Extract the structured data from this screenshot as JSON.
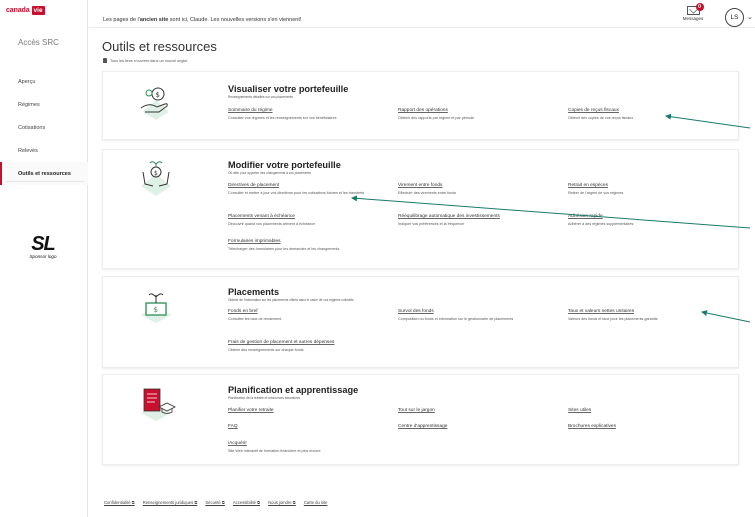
{
  "brand": {
    "name": "canada",
    "tag": "vie"
  },
  "sidebar": {
    "title": "Accès SRC",
    "items": [
      {
        "label": "Aperçu"
      },
      {
        "label": "Régimes"
      },
      {
        "label": "Cotisations"
      },
      {
        "label": "Relevés"
      },
      {
        "label": "Outils et ressources"
      }
    ],
    "sponsor_mono": "SL",
    "sponsor_sub": "Sponsor logo"
  },
  "header": {
    "banner_pre": "Les pages de l'",
    "banner_bold": "ancien site",
    "banner_post": " sont ici, Claude. Les nouvelles versions s'en viennent!",
    "messages_label": "Messages",
    "messages_count": "0",
    "avatar_initials": "LS",
    "caret": "⌄"
  },
  "page": {
    "title": "Outils et ressources",
    "note": "Tous les liens s'ouvrent dans un nouvel onglet"
  },
  "sections": {
    "s1": {
      "title": "Visualiser votre portefeuille",
      "subtitle": "Renseignements détaillés sur vos placements",
      "links": [
        {
          "label": "Sommaire du régime",
          "desc": "Consulter vos régimes et les renseignements sur vos bénéficiaires"
        },
        {
          "label": "Rapport des opérations",
          "desc": "Obtenir des rapports par régime et par période"
        },
        {
          "label": "Copies de reçus fiscaux",
          "desc": "Obtenir des copies de vos reçus fiscaux"
        }
      ]
    },
    "s2": {
      "title": "Modifier votre portefeuille",
      "subtitle": "Où aller pour apporter des changements à vos placements",
      "links": [
        {
          "label": "Directives de placement",
          "desc": "Consulter et mettre à jour vos directives pour les cotisations futures et les transferts"
        },
        {
          "label": "Virement entre fonds",
          "desc": "Effectuer des virements entre fonds"
        },
        {
          "label": "Retrait en espèces",
          "desc": "Retirer de l'argent de vos régimes"
        },
        {
          "label": "Placements venant à échéance",
          "desc": "Découvrir quand vos placements arrivent à échéance"
        },
        {
          "label": "Rééquilibrage automatique des investissements",
          "desc": "Indiquer vos préférences et la fréquence"
        },
        {
          "label": "Adhésion rapide",
          "desc": "Adhérer à des régimes supplémentaires"
        },
        {
          "label": "Formulaires imprimables",
          "desc": "Télécharger des formulaires pour les demandes et les changements"
        }
      ]
    },
    "s3": {
      "title": "Placements",
      "subtitle": "Obtenir de l'information sur les placements offerts dans le cadre de vos régimes collectifs",
      "links": [
        {
          "label": "Fonds en bref",
          "desc": "Consulter les taux de rendement"
        },
        {
          "label": "Survol des fonds",
          "desc": "Composition du fonds et information sur le gestionnaire de placements"
        },
        {
          "label": "Taux et valeurs nettes unitaires",
          "desc": "Valeurs des fonds et taux pour les placements garantis"
        },
        {
          "label": "Frais de gestion de placement et autres dépenses",
          "desc": "Obtenir des renseignements sur chaque fonds"
        }
      ]
    },
    "s4": {
      "title": "Planification et apprentissage",
      "subtitle": "Planification de la retraite et ressources éducatives",
      "links": [
        {
          "label": "Planifier votre retraite",
          "desc": ""
        },
        {
          "label": "Tout sur le jargon",
          "desc": ""
        },
        {
          "label": "Sites utiles",
          "desc": ""
        },
        {
          "label": "FAQ",
          "desc": ""
        },
        {
          "label": "Centre d'apprentissage",
          "desc": ""
        },
        {
          "label": "Brochures explicatives",
          "desc": ""
        },
        {
          "label": "iAcquérir",
          "desc": "Site Web interactif de formation financière et plus encore"
        }
      ]
    }
  },
  "footer": [
    {
      "label": "Confidentialité ⧉"
    },
    {
      "label": "Renseignements juridiques ⧉"
    },
    {
      "label": "Sécurité ⧉"
    },
    {
      "label": "Accessibilité ⧉"
    },
    {
      "label": "Nous joindre ⧉"
    },
    {
      "label": "Carte du site"
    }
  ],
  "colors": {
    "accent": "#c8102e",
    "arrow": "#1a7a6a",
    "illustration": "#2e8b57"
  }
}
